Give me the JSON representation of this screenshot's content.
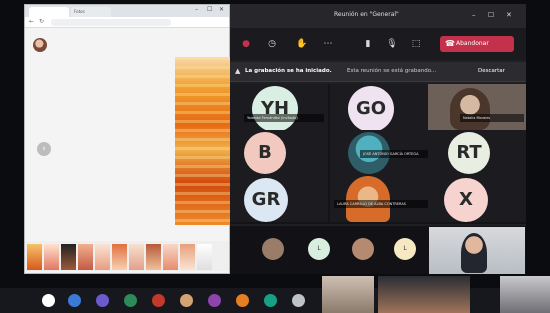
{
  "browser": {
    "tabs": [
      "",
      "Fotos"
    ],
    "address": "",
    "profile_name": "",
    "profile_sub": "",
    "prev_icon": "chevron-left-icon"
  },
  "teams": {
    "title": "Reunión en \"General\"",
    "leave_label": "Abandonar",
    "recording": {
      "bold": "La grabación se ha iniciado.",
      "message": "Esta reunión se está grabando...",
      "dismiss": "Descartar"
    },
    "participants": [
      {
        "initials": "YH",
        "color": "#d9efe4",
        "label": "Yolanda Fernández (Invitado)"
      },
      {
        "initials": "GO",
        "color": "#efe3f1",
        "label": ""
      },
      {
        "initials": "",
        "color": "#7a6a5c",
        "label": "Natalia Morales"
      },
      {
        "initials": "B",
        "color": "#f2c9bf",
        "label": ""
      },
      {
        "initials": "",
        "color": "#3b6f7c",
        "label": "JOSÉ ANTONIO GARCÍA ORTEGA"
      },
      {
        "initials": "RT",
        "color": "#e9eee2",
        "label": ""
      },
      {
        "initials": "GR",
        "color": "#dbe7f2",
        "label": ""
      },
      {
        "initials": "",
        "color": "#d88a46",
        "label": "LAURA CARRILLO DE ALBA CONTRERAS"
      },
      {
        "initials": "X",
        "color": "#f6d3cf",
        "label": ""
      }
    ],
    "bottom_avatars": [
      {
        "text": "",
        "color": "#9a7d68"
      },
      {
        "text": "L",
        "color": "#d8eedf"
      },
      {
        "text": "",
        "color": "#b48a70"
      },
      {
        "text": "L",
        "color": "#f6e9c2"
      }
    ]
  },
  "colors": {
    "leave": "#c4314b",
    "teams_bg": "#1f1f23",
    "taskbar": "#16181e"
  }
}
